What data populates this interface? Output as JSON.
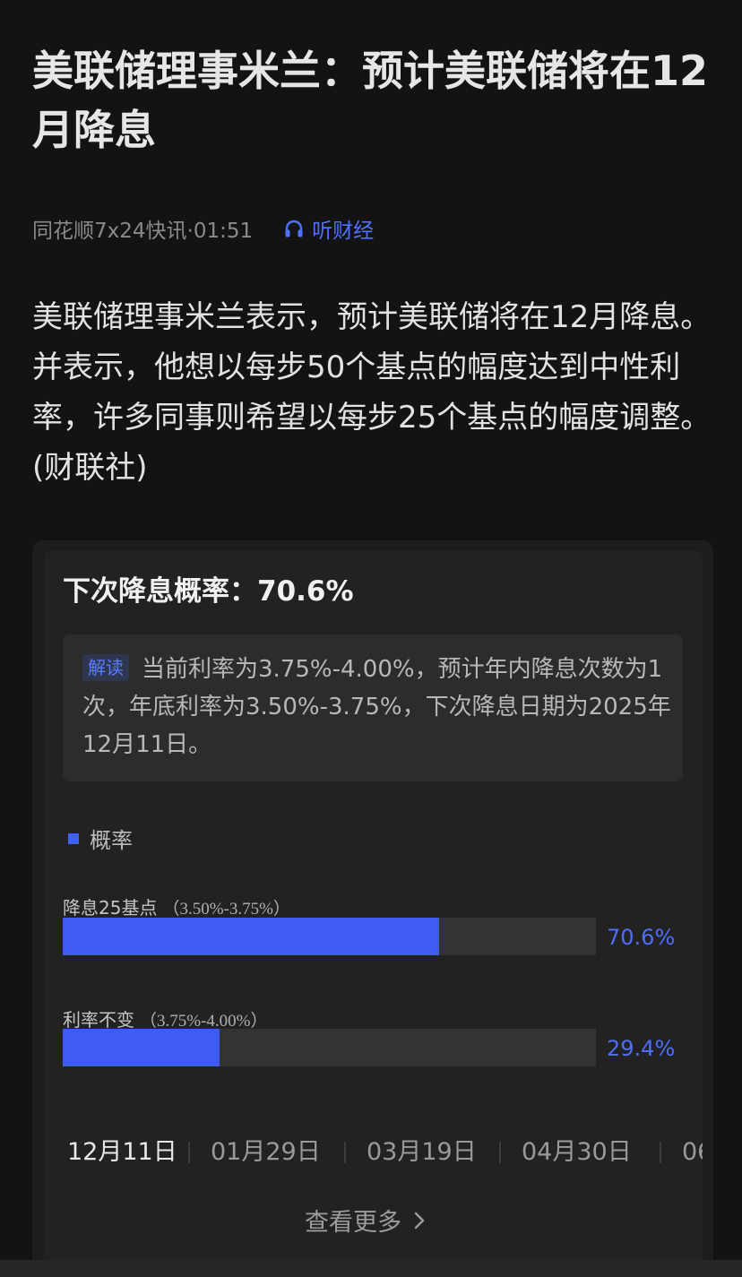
{
  "article": {
    "title": "美联储理事米兰：预计美联储将在12月降息",
    "source_time": "同花顺7x24快讯·01:51",
    "listen_label": "听财经",
    "body": "美联储理事米兰表示，预计美联储将在12月降息。并表示，他想以每步50个基点的幅度达到中性利率，许多同事则希望以每步25个基点的幅度调整。(财联社)"
  },
  "card": {
    "title": "下次降息概率：70.6%",
    "interpret": {
      "tag": "解读",
      "text": "当前利率为3.75%-4.00%，预计年内降息次数为1次，年底利率为3.50%-3.75%，下次降息日期为2025年12月11日。"
    },
    "legend_label": "概率",
    "accent_color": "#3e5cf2",
    "see_more_label": "查看更多"
  },
  "chart_data": {
    "type": "bar",
    "orientation": "horizontal",
    "legend": [
      "概率"
    ],
    "categories": [
      "降息25基点",
      "利率不变"
    ],
    "ranges": [
      "（3.50%-3.75%）",
      "（3.75%-4.00%）"
    ],
    "values": [
      70.6,
      29.4
    ],
    "value_labels": [
      "70.6%",
      "29.4%"
    ],
    "xlim": [
      0,
      100
    ],
    "grid": false
  },
  "dates": [
    "12月11日",
    "01月29日",
    "03月19日",
    "04月30日",
    "06"
  ]
}
